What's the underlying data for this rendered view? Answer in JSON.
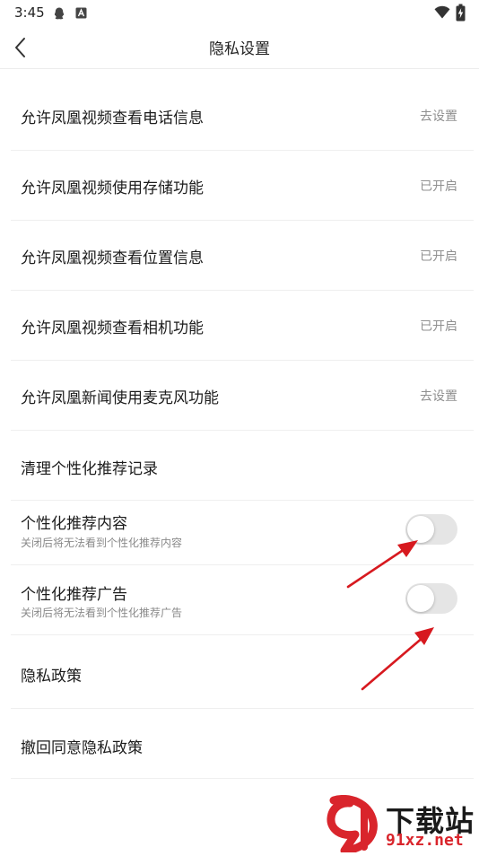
{
  "status_bar": {
    "time": "3:45",
    "icons": [
      "qq-icon",
      "app-a-icon",
      "wifi-icon",
      "battery-charging-icon"
    ]
  },
  "nav": {
    "title": "隐私设置",
    "back_icon": "chevron-left-icon"
  },
  "permissions": [
    {
      "label": "允许凤凰视频查看电话信息",
      "status": "去设置"
    },
    {
      "label": "允许凤凰视频使用存储功能",
      "status": "已开启"
    },
    {
      "label": "允许凤凰视频查看位置信息",
      "status": "已开启"
    },
    {
      "label": "允许凤凰视频查看相机功能",
      "status": "已开启"
    },
    {
      "label": "允许凤凰新闻使用麦克风功能",
      "status": "去设置"
    }
  ],
  "clear_history": {
    "label": "清理个性化推荐记录"
  },
  "toggles": [
    {
      "label": "个性化推荐内容",
      "subtitle": "关闭后将无法看到个性化推荐内容",
      "enabled": false
    },
    {
      "label": "个性化推荐广告",
      "subtitle": "关闭后将无法看到个性化推荐广告",
      "enabled": false
    }
  ],
  "policy": {
    "label": "隐私政策"
  },
  "revoke": {
    "label": "撤回同意隐私政策"
  },
  "annotation_color": "#d7191f",
  "watermark": {
    "main": "下载站",
    "url": "91xz.net",
    "logo_icon": "91-logo-icon"
  }
}
